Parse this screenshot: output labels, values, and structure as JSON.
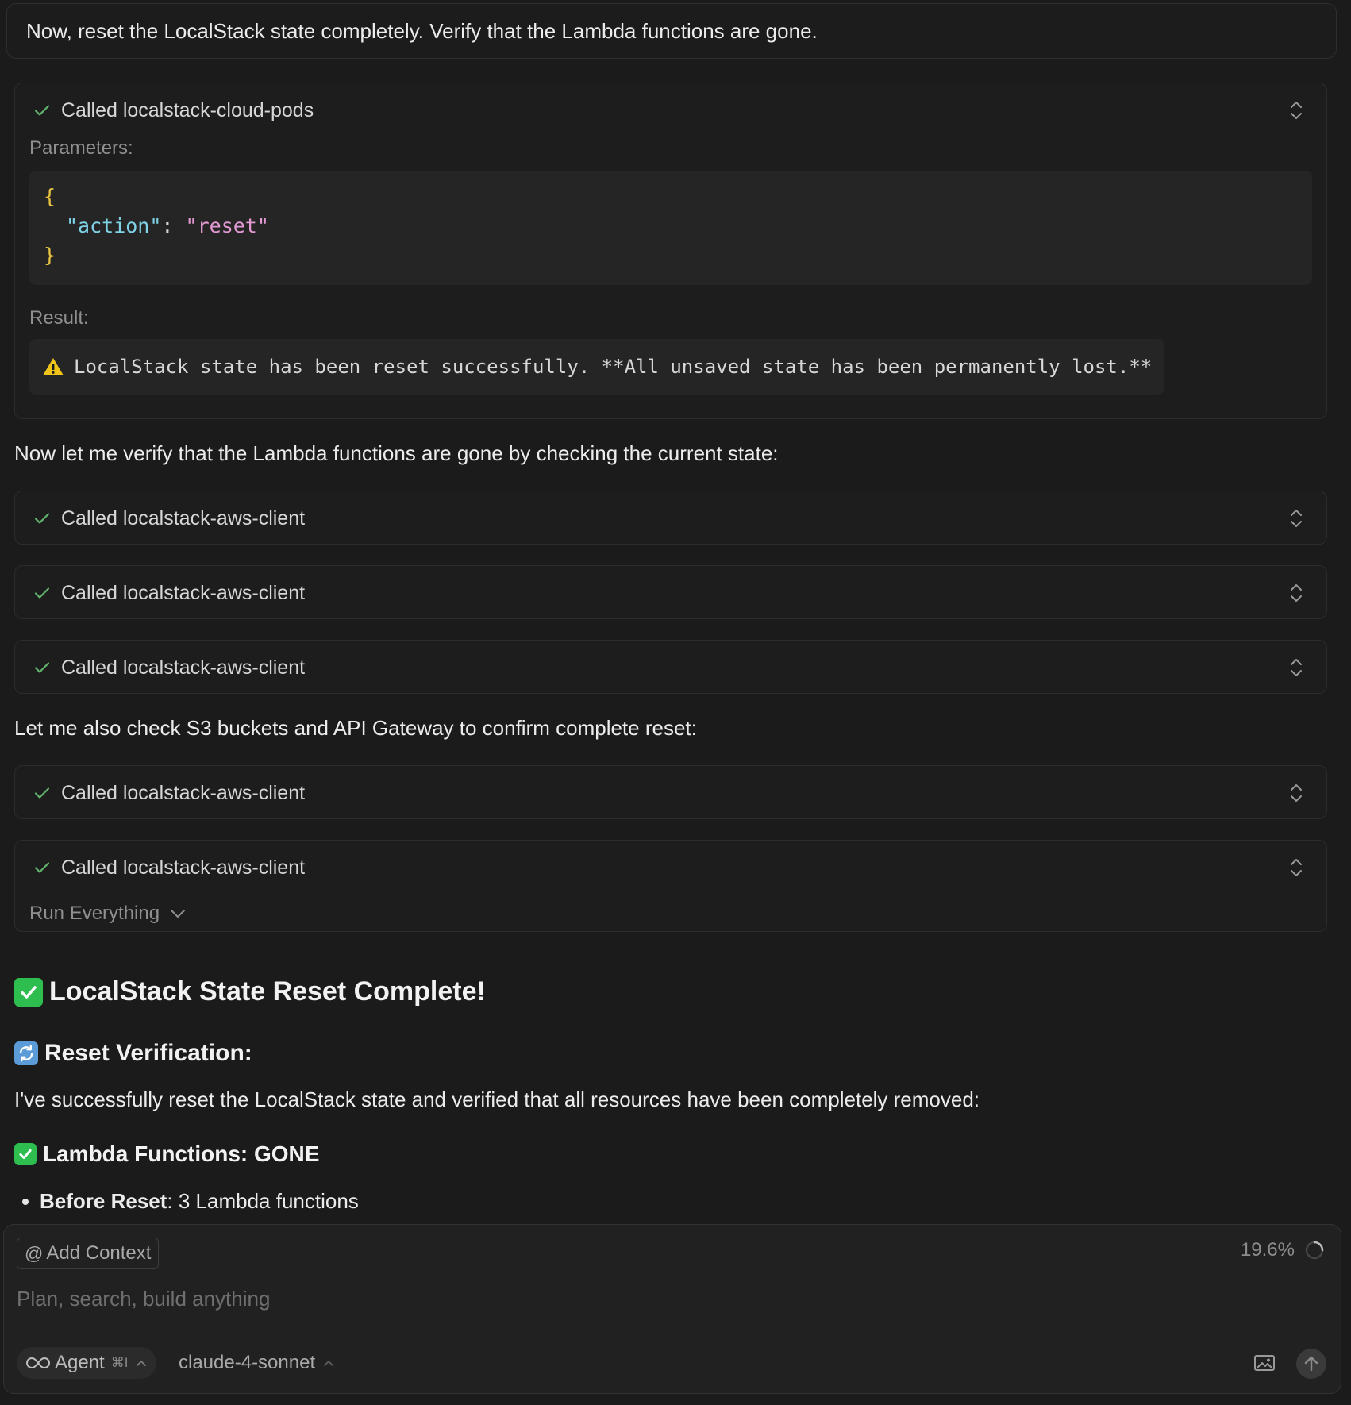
{
  "user_message": "Now, reset the LocalStack state completely. Verify that the Lambda functions are gone.",
  "tool_call_1": {
    "title": "Called localstack-cloud-pods",
    "parameters_label": "Parameters:",
    "code_open": "{",
    "code_key": "\"action\"",
    "code_colon": ":",
    "code_value": "\"reset\"",
    "code_close": "}",
    "result_label": "Result:",
    "result_text": "LocalStack state has been reset successfully. **All unsaved state has been permanently lost.**"
  },
  "para_verify": "Now let me verify that the Lambda functions are gone by checking the current state:",
  "tool_calls_group_1": [
    {
      "title": "Called localstack-aws-client"
    },
    {
      "title": "Called localstack-aws-client"
    },
    {
      "title": "Called localstack-aws-client"
    }
  ],
  "para_s3": "Let me also check S3 buckets and API Gateway to confirm complete reset:",
  "tool_calls_group_2": [
    {
      "title": "Called localstack-aws-client"
    },
    {
      "title": "Called localstack-aws-client"
    }
  ],
  "run_everything": "Run Everything",
  "heading_complete": "LocalStack State Reset Complete!",
  "heading_verification": "Reset Verification:",
  "para_success": "I've successfully reset the LocalStack state and verified that all resources have been completely removed:",
  "heading_lambda": "Lambda Functions: GONE",
  "bullet_before": {
    "label": "Before Reset",
    "text": ": 3 Lambda functions"
  },
  "composer": {
    "add_context": "Add Context",
    "context_usage": "19.6%",
    "placeholder": "Plan, search, build anything",
    "mode": "Agent",
    "mode_shortcut": "⌘I",
    "model": "claude-4-sonnet"
  },
  "colors": {
    "background": "#1b1b1b",
    "check_green": "#5fb36a",
    "emoji_green": "#2ebd4f",
    "emoji_blue": "#5a9bd8",
    "warning_yellow": "#f0c419"
  },
  "icons": [
    "check-icon",
    "chevron-updown-icon",
    "warning-icon",
    "chevron-down-icon",
    "check-emoji-icon",
    "refresh-emoji-icon",
    "infinity-icon",
    "image-icon",
    "arrow-up-icon",
    "spinner-icon"
  ]
}
